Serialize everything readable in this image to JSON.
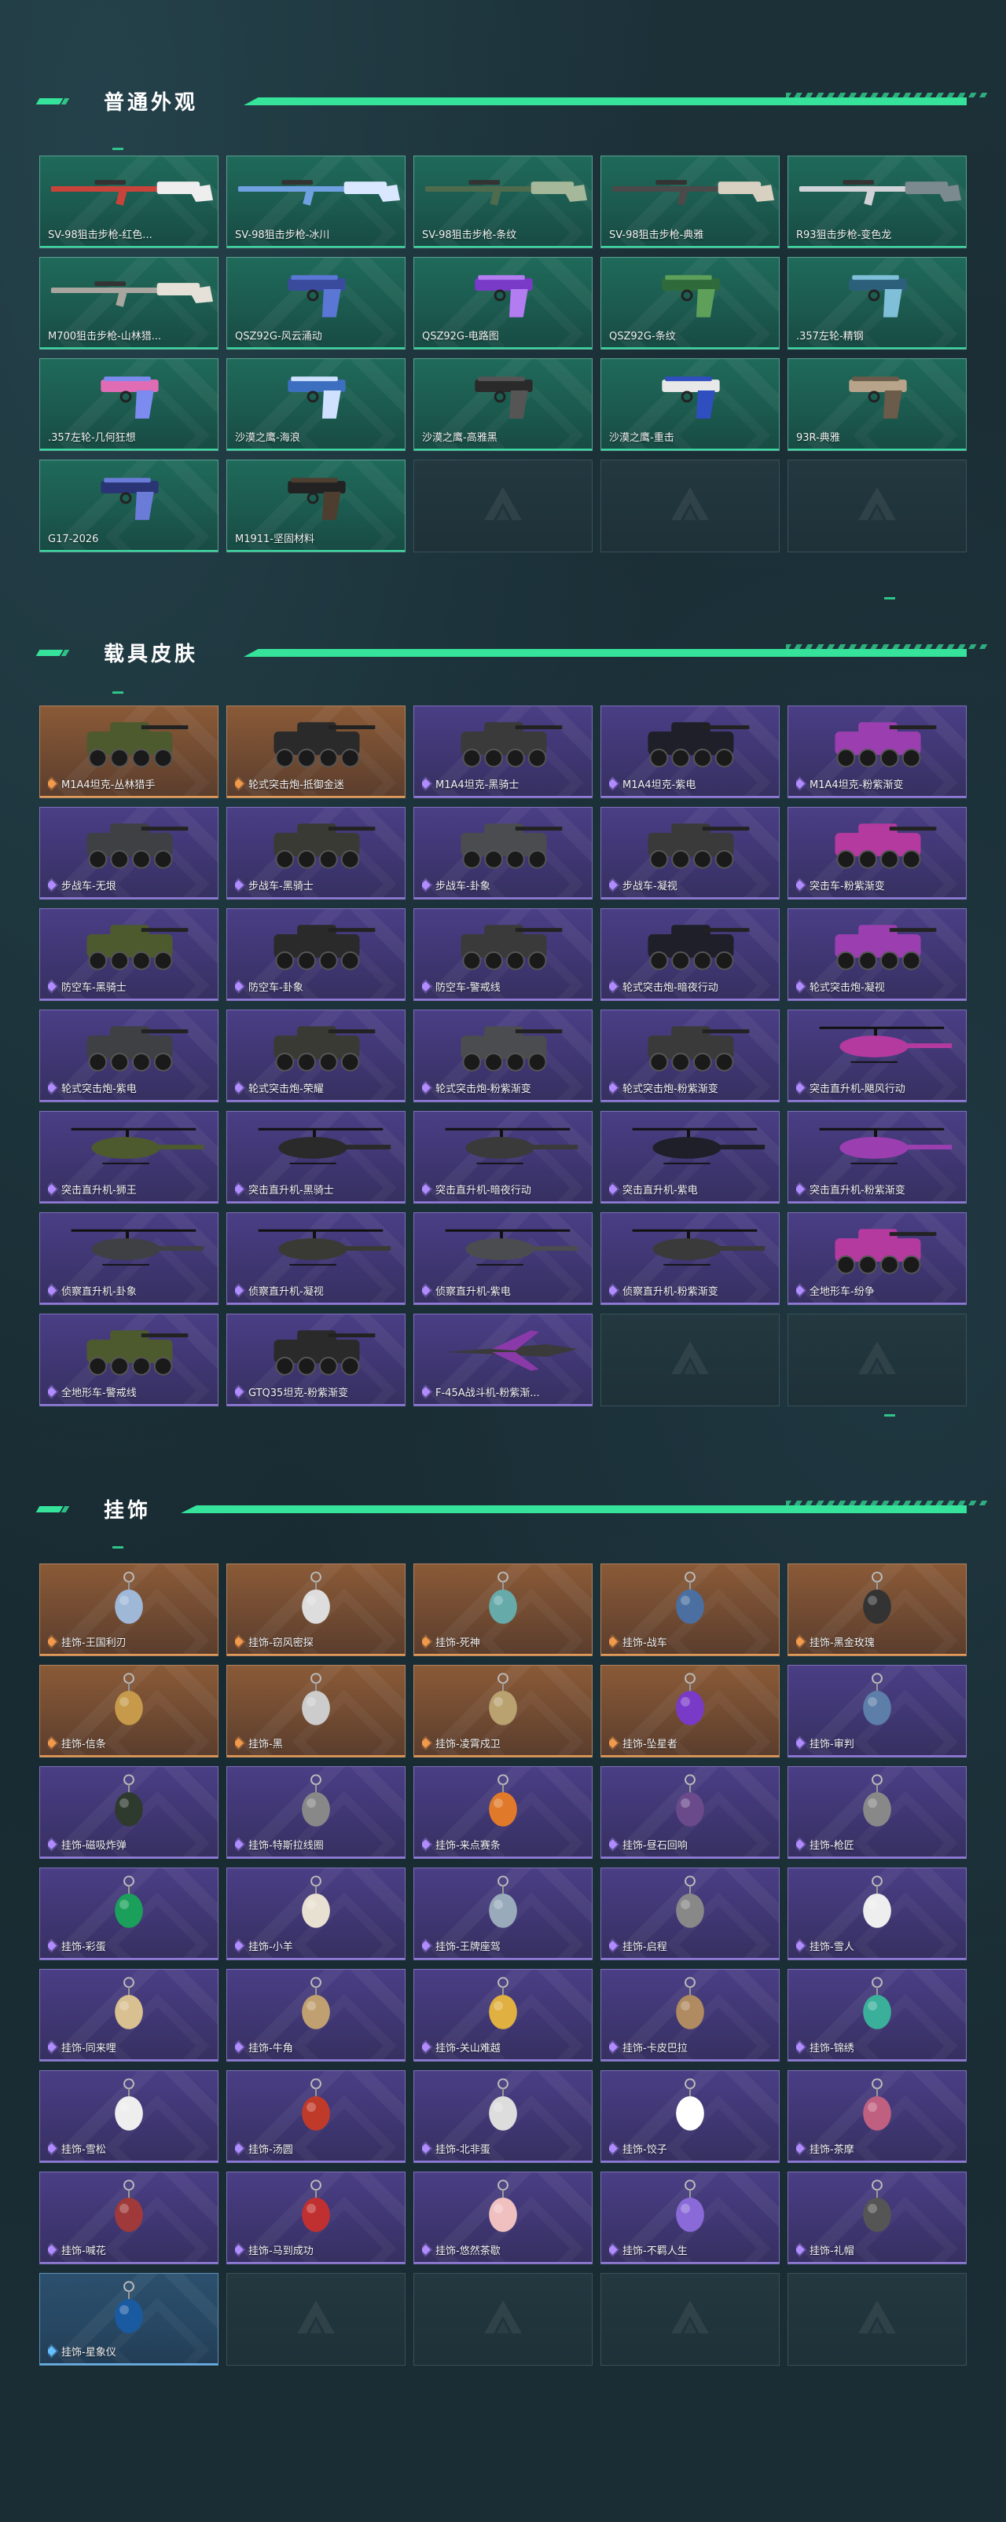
{
  "sections": {
    "weapons": {
      "title": "普通外观",
      "items": [
        "SV-98狙击步枪-红色...",
        "SV-98狙击步枪-冰川",
        "SV-98狙击步枪-条纹",
        "SV-98狙击步枪-典雅",
        "R93狙击步枪-变色龙",
        "M700狙击步枪-山林猎...",
        "QSZ92G-风云涌动",
        "QSZ92G-电路图",
        "QSZ92G-条纹",
        ".357左轮-精钢",
        ".357左轮-几何狂想",
        "沙漠之鹰-海浪",
        "沙漠之鹰-高雅黑",
        "沙漠之鹰-重击",
        "93R-典雅",
        "G17-2026",
        "M1911-坚固材料"
      ]
    },
    "vehicles": {
      "title": "载具皮肤",
      "items": [
        "M1A4坦克-丛林猎手",
        "轮式突击炮-抵御金迷",
        "M1A4坦克-黑骑士",
        "M1A4坦克-紫电",
        "M1A4坦克-粉紫渐变",
        "步战车-无垠",
        "步战车-黑骑士",
        "步战车-卦象",
        "步战车-凝视",
        "突击车-粉紫渐变",
        "防空车-黑骑士",
        "防空车-卦象",
        "防空车-警戒线",
        "轮式突击炮-暗夜行动",
        "轮式突击炮-凝视",
        "轮式突击炮-紫电",
        "轮式突击炮-荣耀",
        "轮式突击炮-粉紫渐变",
        "轮式突击炮-粉紫渐变",
        "突击直升机-飓风行动",
        "突击直升机-狮王",
        "突击直升机-黑骑士",
        "突击直升机-暗夜行动",
        "突击直升机-紫电",
        "突击直升机-粉紫渐变",
        "侦察直升机-卦象",
        "侦察直升机-凝视",
        "侦察直升机-紫电",
        "侦察直升机-粉紫渐变",
        "全地形车-纷争",
        "全地形车-警戒线",
        "GTQ35坦克-粉紫渐变",
        "F-45A战斗机-粉紫渐..."
      ]
    },
    "charms": {
      "title": "挂饰",
      "items": [
        "挂饰-王国利刃",
        "挂饰-窃风密探",
        "挂饰-死神",
        "挂饰-战车",
        "挂饰-黑金玫瑰",
        "挂饰-信条",
        "挂饰-黑",
        "挂饰-凌霄戍卫",
        "挂饰-坠星者",
        "挂饰-审判",
        "挂饰-磁吸炸弹",
        "挂饰-特斯拉线圈",
        "挂饰-来点赛条",
        "挂饰-昼石回响",
        "挂饰-枪匠",
        "挂饰-彩蛋",
        "挂饰-小羊",
        "挂饰-王牌座驾",
        "挂饰-启程",
        "挂饰-雪人",
        "挂饰-同来哩",
        "挂饰-牛角",
        "挂饰-关山难越",
        "挂饰-卡皮巴拉",
        "挂饰-锦绣",
        "挂饰-雪松",
        "挂饰-汤圆",
        "挂饰-北非蛋",
        "挂饰-饺子",
        "挂饰-茶摩",
        "挂饰-喊花",
        "挂饰-马到成功",
        "挂饰-悠然茶歇",
        "挂饰-不羁人生",
        "挂饰-礼帽",
        "挂饰-星象仪"
      ]
    }
  },
  "colors": {
    "accent": "#35e39a",
    "green_card": "#1f6a5a",
    "orange_card": "#8a5a37",
    "purple_card": "#4a3e85",
    "blue_card": "#2b4f6d",
    "empty_card": "#23383f"
  },
  "rarity": {
    "vehicles": [
      "orange",
      "orange",
      "purple",
      "purple",
      "purple",
      "purple",
      "purple",
      "purple",
      "purple",
      "purple",
      "purple",
      "purple",
      "purple",
      "purple",
      "purple",
      "purple",
      "purple",
      "purple",
      "purple",
      "purple",
      "purple",
      "purple",
      "purple",
      "purple",
      "purple",
      "purple",
      "purple",
      "purple",
      "purple",
      "purple",
      "purple",
      "purple",
      "purple"
    ],
    "charms": [
      "orange",
      "orange",
      "orange",
      "orange",
      "orange",
      "orange",
      "orange",
      "orange",
      "orange",
      "purple",
      "purple",
      "purple",
      "purple",
      "purple",
      "purple",
      "purple",
      "purple",
      "purple",
      "purple",
      "purple",
      "purple",
      "purple",
      "purple",
      "purple",
      "purple",
      "purple",
      "purple",
      "purple",
      "purple",
      "purple",
      "purple",
      "purple",
      "purple",
      "purple",
      "purple",
      "blue"
    ]
  },
  "icons": {
    "weapon": "weapon-icon",
    "vehicle": "vehicle-icon",
    "charm": "charm-icon",
    "empty": "placeholder-logo-icon",
    "rarity": "rarity-gem-icon"
  }
}
